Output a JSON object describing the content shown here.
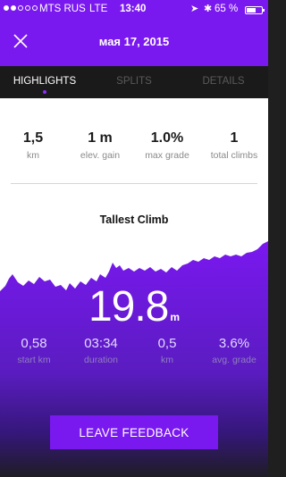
{
  "status_bar": {
    "carrier": "MTS RUS",
    "network": "LTE",
    "time": "13:40",
    "battery_percent": "65 %",
    "battery_level": 0.65,
    "signal_bars_filled": 2,
    "signal_bars_total": 5
  },
  "header": {
    "title": "мая 17, 2015",
    "close_icon": "close-icon"
  },
  "tabs": [
    {
      "label": "HIGHLIGHTS",
      "active": true
    },
    {
      "label": "SPLITS",
      "active": false
    },
    {
      "label": "DETAILS",
      "active": false
    }
  ],
  "summary": [
    {
      "value": "1,5",
      "label": "km"
    },
    {
      "value": "1 m",
      "label": "elev. gain"
    },
    {
      "value": "1.0%",
      "label": "max grade"
    },
    {
      "value": "1",
      "label": "total climbs"
    }
  ],
  "climb": {
    "title": "Tallest Climb",
    "elevation_value": "19.8",
    "elevation_unit": "m",
    "stats": [
      {
        "value": "0,58",
        "label": "start km"
      },
      {
        "value": "03:34",
        "label": "duration"
      },
      {
        "value": "0,5",
        "label": "km"
      },
      {
        "value": "3.6%",
        "label": "avg. grade"
      }
    ]
  },
  "feedback_button": {
    "label": "LEAVE FEEDBACK"
  },
  "colors": {
    "accent": "#7a18f0",
    "tab_bar": "#1a1a1a",
    "background_dark": "#1d1d1d"
  }
}
